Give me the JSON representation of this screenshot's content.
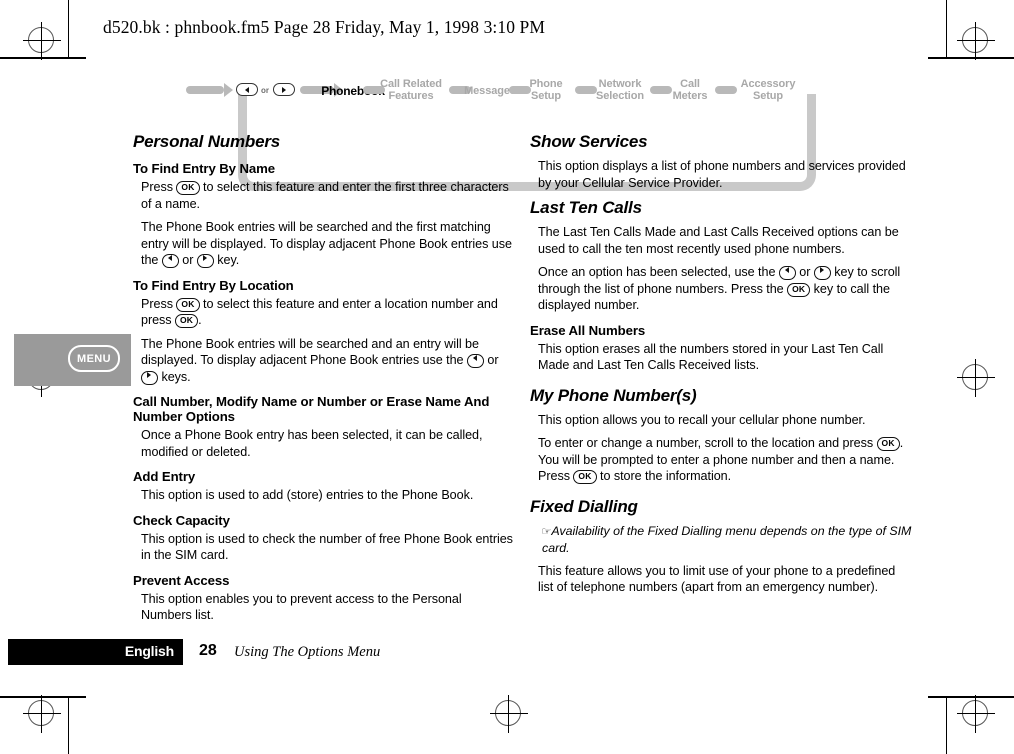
{
  "running_header": "d520.bk : phnbook.fm5  Page 28  Friday, May 1, 1998  3:10 PM",
  "side_tab": {
    "key_label": "MENU"
  },
  "nav_flow": {
    "or_label": "or",
    "items": [
      {
        "label": "Phonebook",
        "current": true
      },
      {
        "label": "Call Related\nFeatures",
        "current": false
      },
      {
        "label": "Messages",
        "current": false
      },
      {
        "label": "Phone\nSetup",
        "current": false
      },
      {
        "label": "Network\nSelection",
        "current": false
      },
      {
        "label": "Call\nMeters",
        "current": false
      },
      {
        "label": "Accessory\nSetup",
        "current": false
      }
    ],
    "labels": {
      "phonebook": "Phonebook",
      "call_related_1": "Call Related",
      "call_related_2": "Features",
      "messages": "Messages",
      "phone_setup_1": "Phone",
      "phone_setup_2": "Setup",
      "network_1": "Network",
      "network_2": "Selection",
      "call_meters_1": "Call",
      "call_meters_2": "Meters",
      "accessory_1": "Accessory",
      "accessory_2": "Setup"
    }
  },
  "left_column": {
    "section_title": "Personal Numbers",
    "h_find_name": "To Find Entry By Name",
    "p_find_name_1a": "Press ",
    "p_find_name_1b": " to select this feature and enter the first three characters of a name.",
    "p_find_name_2a": "The Phone Book entries will be searched and the first matching entry will be displayed. To display adjacent Phone Book entries use the ",
    "p_find_name_2b": " or ",
    "p_find_name_2c": " key.",
    "h_find_location": "To Find Entry By Location",
    "p_find_location_1a": "Press ",
    "p_find_location_1b": " to select this feature and enter a location number and press ",
    "p_find_location_1c": ".",
    "p_find_location_2a": "The Phone Book entries will be searched and an entry will be displayed. To display adjacent Phone Book entries use the ",
    "p_find_location_2b": " or ",
    "p_find_location_2c": " keys.",
    "h_call_number": "Call Number, Modify Name or Number or Erase Name And Number Options",
    "p_call_number": "Once a Phone Book entry has been selected, it can be called, modified or deleted.",
    "h_add_entry": "Add Entry",
    "p_add_entry": "This option is used to add (store) entries to the Phone Book.",
    "h_check_capacity": "Check Capacity",
    "p_check_capacity": "This option is used to check the number of free Phone Book entries in the SIM card.",
    "h_prevent_access": "Prevent Access",
    "p_prevent_access": "This option enables you to prevent access to the Personal Numbers list."
  },
  "right_column": {
    "h_show_services": "Show Services",
    "p_show_services": "This option displays a list of phone numbers and services provided by your Cellular Service Provider.",
    "h_last_ten": "Last Ten Calls",
    "p_last_ten_1": "The Last Ten Calls Made and Last Calls Received options can be used to call the ten most recently used phone numbers.",
    "p_last_ten_2a": "Once an option has been selected, use the ",
    "p_last_ten_2b": " or ",
    "p_last_ten_2c": " key to scroll through the list of phone numbers. Press the ",
    "p_last_ten_2d": " key to call the displayed number.",
    "h_erase_all": "Erase All Numbers",
    "p_erase_all": "This option erases all the numbers stored in your Last Ten Call Made and Last Ten Calls Received lists.",
    "h_my_phone": "My Phone Number(s)",
    "p_my_phone_1": "This option allows you to recall your cellular phone number.",
    "p_my_phone_2a": "To enter or change a number, scroll to the location and press ",
    "p_my_phone_2b": ". You will be prompted to enter a phone number and then a name. Press ",
    "p_my_phone_2c": " to store the information.",
    "h_fixed_dialling": "Fixed Dialling",
    "note_icon": "☞",
    "p_fixed_note": "Availability of the Fixed Dialling menu depends on the type of SIM card.",
    "p_fixed_body": "This feature allows you to limit use of your phone to a predefined list of telephone numbers (apart from an emergency number)."
  },
  "keys": {
    "ok": "OK"
  },
  "footer": {
    "language": "English",
    "page_number": "28",
    "chapter_title": "Using The Options Menu"
  }
}
